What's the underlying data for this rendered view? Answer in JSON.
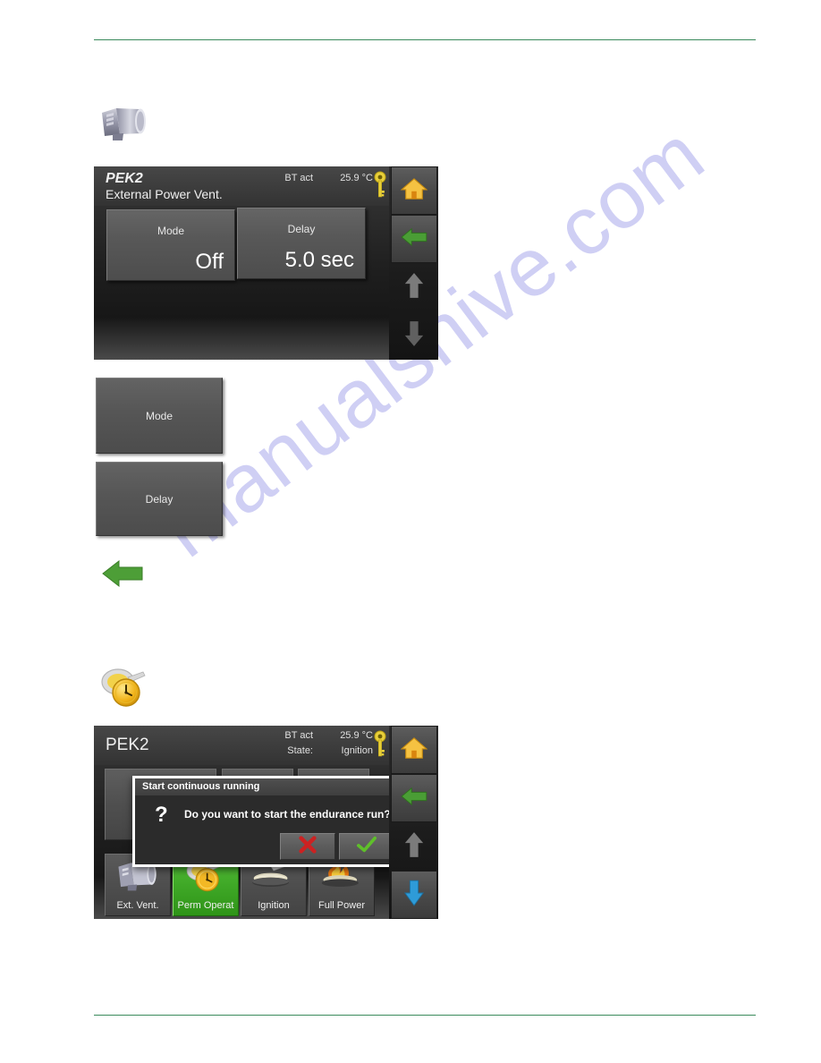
{
  "page": {
    "watermark": "manualshive.com",
    "rule_color": "#3a8a5c"
  },
  "icons": {
    "blower": "blower-motor-icon",
    "perm_operation": "clock-coin-icon",
    "back_arrow": "green-left-arrow-icon",
    "home": "home-icon",
    "key": "key-icon",
    "up": "up-arrow-icon",
    "down": "down-arrow-icon"
  },
  "panel_one": {
    "title": "PEK2",
    "subtitle": "External Power Vent.",
    "meta": {
      "label": "BT act",
      "value": "25.9 °C"
    },
    "buttons": [
      {
        "label": "Mode",
        "value": "Off"
      },
      {
        "label": "Delay",
        "value": "5.0 sec"
      }
    ],
    "nav": [
      {
        "name": "home-button",
        "icon": "home-icon",
        "state": "active"
      },
      {
        "name": "back-button",
        "icon": "green-left-arrow-icon",
        "state": "active"
      },
      {
        "name": "scroll-up-button",
        "icon": "up-arrow-icon",
        "state": "disabled"
      },
      {
        "name": "scroll-down-button",
        "icon": "down-arrow-icon",
        "state": "disabled"
      }
    ]
  },
  "sample_buttons": [
    {
      "label": "Mode"
    },
    {
      "label": "Delay"
    }
  ],
  "panel_two": {
    "title": "PEK2",
    "meta": [
      {
        "label": "BT act",
        "value": "25.9 °C"
      },
      {
        "label": "State:",
        "value": "Ignition"
      }
    ],
    "tabs": [
      {
        "label": "Ext. Vent.",
        "icon": "blower-motor-icon",
        "selected": false
      },
      {
        "label": "Perm Operat",
        "icon": "clock-coin-icon",
        "selected": true
      },
      {
        "label": "Ignition",
        "icon": "ignition-pan-icon",
        "selected": false
      },
      {
        "label": "Full Power",
        "icon": "flame-icon",
        "selected": false
      }
    ],
    "nav": [
      {
        "name": "home-button",
        "icon": "home-icon",
        "state": "active"
      },
      {
        "name": "back-button",
        "icon": "green-left-arrow-icon",
        "state": "active"
      },
      {
        "name": "scroll-up-button",
        "icon": "up-arrow-icon",
        "state": "disabled"
      },
      {
        "name": "scroll-down-button",
        "icon": "down-arrow-icon",
        "state": "active"
      }
    ],
    "dialog": {
      "title": "Start continuous running",
      "question_mark": "?",
      "message": "Do you want to start the endurance run?",
      "cancel": "cancel-button",
      "confirm": "confirm-button"
    }
  },
  "colors": {
    "accent_green": "#3fa827",
    "home_orange": "#f5a623",
    "key_yellow": "#e8cf3a",
    "arrow_green": "#4a9d35",
    "arrow_blue": "#2e9bd8",
    "error_red": "#cc2222",
    "watermark": "#cfcff4"
  }
}
